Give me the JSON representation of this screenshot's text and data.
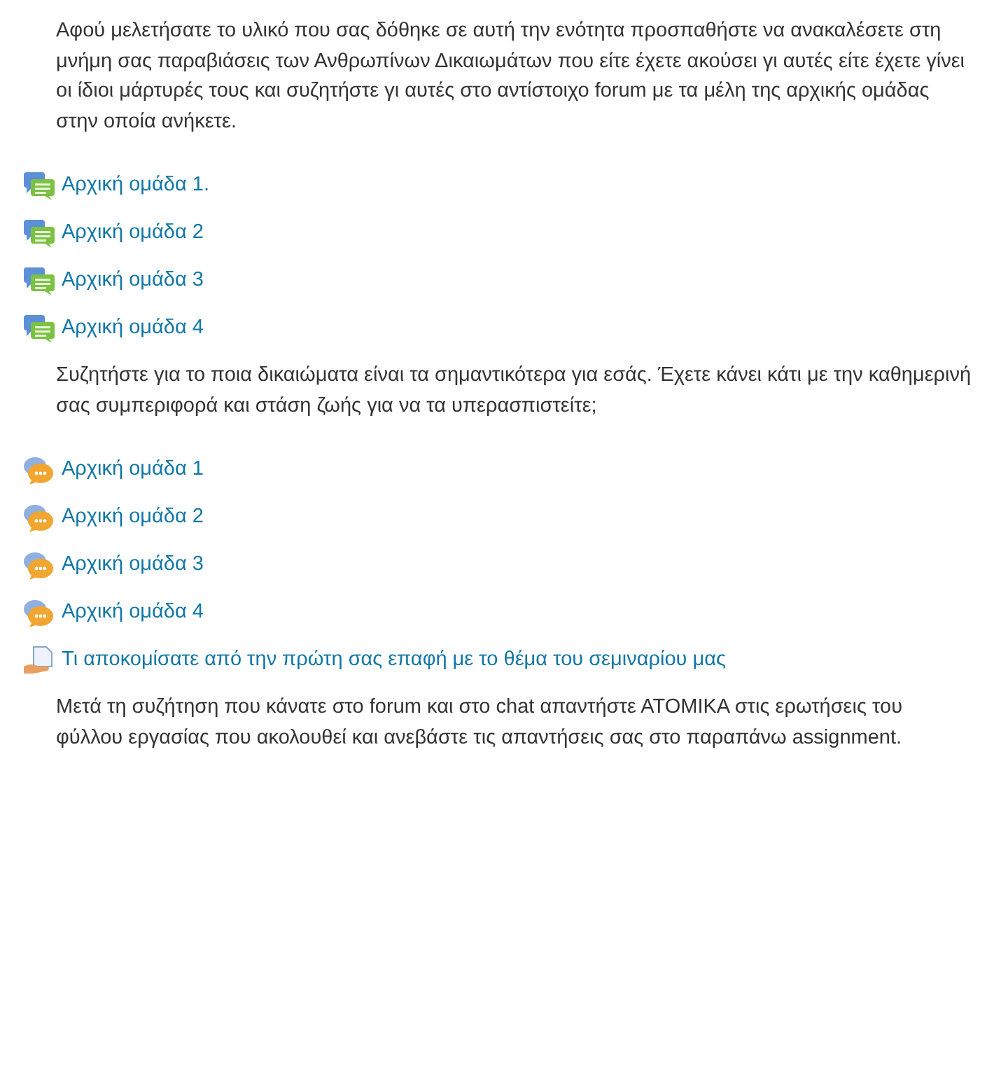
{
  "content": [
    {
      "kind": "paragraph",
      "text": "Αφού μελετήσατε το υλικό που σας δόθηκε σε αυτή την ενότητα προσπαθήστε να ανακαλέσετε στη μνήμη σας παραβιάσεις των Ανθρωπίνων Δικαιωμάτων που είτε έχετε ακούσει γι αυτές είτε έχετε γίνει οι ίδιοι μάρτυρές τους και συζητήστε γι αυτές στο αντίστοιχο forum με τα μέλη της αρχικής ομάδας στην οποία ανήκετε."
    },
    {
      "kind": "forum",
      "text": "Αρχική ομάδα 1."
    },
    {
      "kind": "forum",
      "text": "Αρχική ομάδα 2"
    },
    {
      "kind": "forum",
      "text": "Αρχική ομάδα 3"
    },
    {
      "kind": "forum",
      "text": "Αρχική ομάδα 4"
    },
    {
      "kind": "paragraph",
      "text": "Συζητήστε για το ποια δικαιώματα είναι τα σημαντικότερα για εσάς. Έχετε κάνει κάτι με την καθημερινή σας συμπεριφορά και στάση ζωής για να τα υπερασπιστείτε;"
    },
    {
      "kind": "chat",
      "text": "Αρχική ομάδα 1"
    },
    {
      "kind": "chat",
      "text": "Αρχική ομάδα 2"
    },
    {
      "kind": "chat",
      "text": "Αρχική ομάδα 3"
    },
    {
      "kind": "chat",
      "text": "Αρχική ομάδα 4"
    },
    {
      "kind": "assignment",
      "text": "Τι αποκομίσατε από την πρώτη σας επαφή με το θέμα του σεμιναρίου μας"
    },
    {
      "kind": "paragraph",
      "text": "Μετά τη συζήτηση που κάνατε στο forum και στο chat απαντήστε ΑΤΟΜΙΚΑ  στις ερωτήσεις του φύλλου εργασίας που ακολουθεί και ανεβάστε τις απαντήσεις σας στο παραπάνω assignment."
    }
  ]
}
